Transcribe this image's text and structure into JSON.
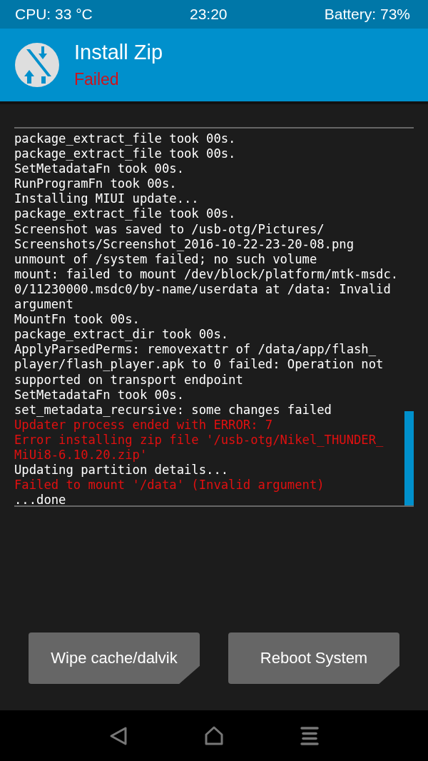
{
  "status_bar": {
    "cpu": "CPU: 33 °C",
    "time": "23:20",
    "battery": "Battery: 73%"
  },
  "header": {
    "title": "Install Zip",
    "status": "Failed"
  },
  "log": [
    {
      "text": "package_extract_file took 00s.",
      "kind": "normal"
    },
    {
      "text": "package_extract_file took 00s.",
      "kind": "normal"
    },
    {
      "text": "SetMetadataFn took 00s.",
      "kind": "normal"
    },
    {
      "text": "RunProgramFn took 00s.",
      "kind": "normal"
    },
    {
      "text": "Installing MIUI update...",
      "kind": "normal"
    },
    {
      "text": "package_extract_file took 00s.",
      "kind": "normal"
    },
    {
      "text": "Screenshot was saved to /usb-otg/Pictures/",
      "kind": "normal"
    },
    {
      "text": "Screenshots/Screenshot_2016-10-22-23-20-08.png",
      "kind": "normal"
    },
    {
      "text": "unmount of /system failed; no such volume",
      "kind": "normal"
    },
    {
      "text": "mount: failed to mount /dev/block/platform/mtk-msdc.",
      "kind": "normal"
    },
    {
      "text": "0/11230000.msdc0/by-name/userdata at /data: Invalid",
      "kind": "normal"
    },
    {
      "text": "argument",
      "kind": "normal"
    },
    {
      "text": "MountFn took 00s.",
      "kind": "normal"
    },
    {
      "text": "package_extract_dir took 00s.",
      "kind": "normal"
    },
    {
      "text": "ApplyParsedPerms: removexattr of /data/app/flash_",
      "kind": "normal"
    },
    {
      "text": "player/flash_player.apk to 0 failed: Operation not",
      "kind": "normal"
    },
    {
      "text": "supported on transport endpoint",
      "kind": "normal"
    },
    {
      "text": "SetMetadataFn took 00s.",
      "kind": "normal"
    },
    {
      "text": "set_metadata_recursive: some changes failed",
      "kind": "normal"
    },
    {
      "text": "Updater process ended with ERROR: 7",
      "kind": "error"
    },
    {
      "text": "Error installing zip file '/usb-otg/Nikel_THUNDER_",
      "kind": "error"
    },
    {
      "text": "MiUi8-6.10.20.zip'",
      "kind": "error"
    },
    {
      "text": "Updating partition details...",
      "kind": "normal"
    },
    {
      "text": "Failed to mount '/data' (Invalid argument)",
      "kind": "error"
    },
    {
      "text": "...done",
      "kind": "normal"
    }
  ],
  "buttons": [
    {
      "label": "Wipe cache/dalvik"
    },
    {
      "label": "Reboot System"
    }
  ]
}
